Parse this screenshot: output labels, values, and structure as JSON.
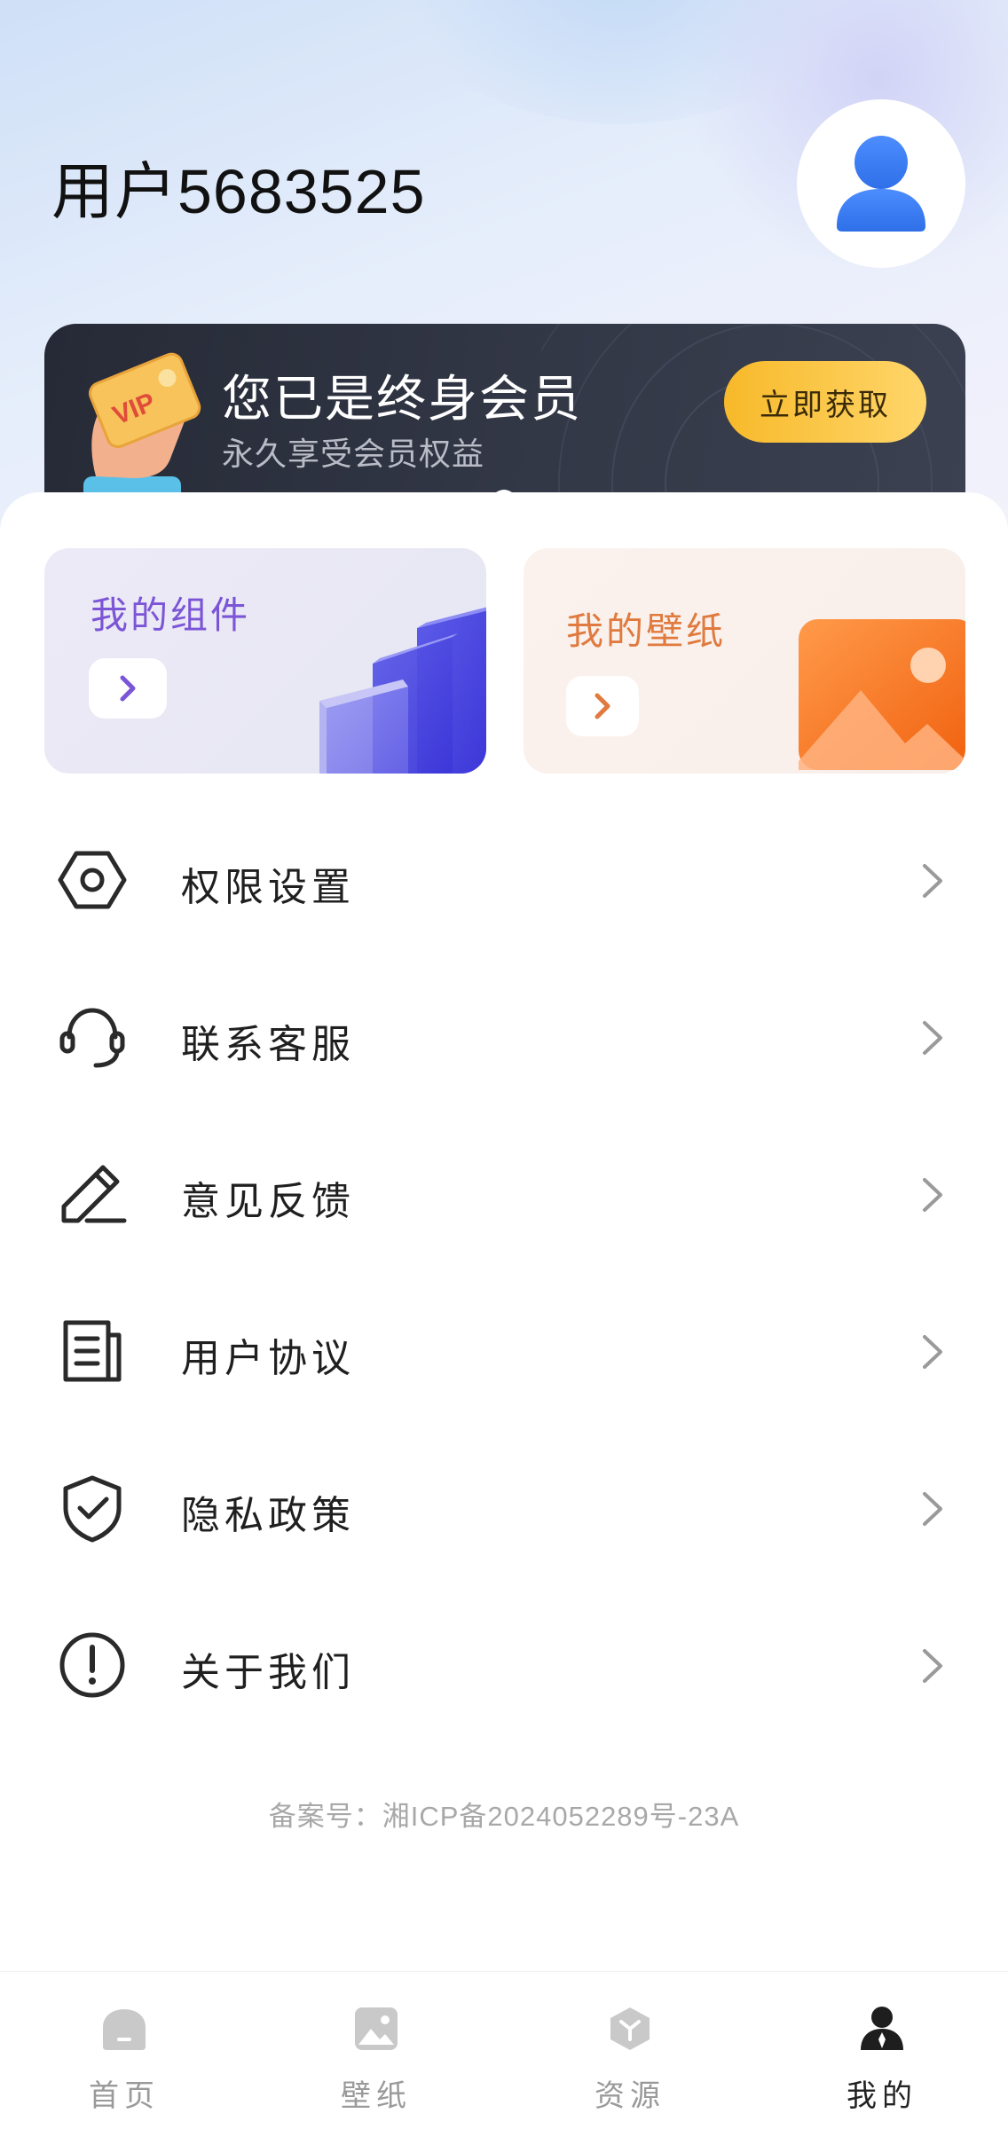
{
  "profile": {
    "username": "用户5683525"
  },
  "vip": {
    "title": "您已是终身会员",
    "subtitle": "永久享受会员权益",
    "button_label": "立即获取",
    "badge_text": "VIP"
  },
  "tiles": [
    {
      "title": "我的组件",
      "icon": "chevron-right-icon",
      "accent": "#7b55d6"
    },
    {
      "title": "我的壁纸",
      "icon": "chevron-right-icon",
      "accent": "#e07a3e"
    }
  ],
  "menu": [
    {
      "label": "权限设置",
      "icon": "hexagon-settings-icon"
    },
    {
      "label": "联系客服",
      "icon": "headset-icon"
    },
    {
      "label": "意见反馈",
      "icon": "pencil-icon"
    },
    {
      "label": "用户协议",
      "icon": "document-icon"
    },
    {
      "label": "隐私政策",
      "icon": "shield-check-icon"
    },
    {
      "label": "关于我们",
      "icon": "info-exclamation-icon"
    }
  ],
  "footer": {
    "icp": "备案号：湘ICP备2024052289号-23A"
  },
  "tabbar": {
    "tabs": [
      {
        "label": "首页",
        "icon": "home-icon",
        "active": false
      },
      {
        "label": "壁纸",
        "icon": "image-icon",
        "active": false
      },
      {
        "label": "资源",
        "icon": "cube-icon",
        "active": false
      },
      {
        "label": "我的",
        "icon": "user-icon",
        "active": true
      }
    ]
  },
  "colors": {
    "vip_card": "#2e323f",
    "vip_button": "#f7b92a",
    "avatar_blue": "#3b82f6",
    "text_primary": "#1f1f1f",
    "text_muted": "#9a9a9a"
  }
}
